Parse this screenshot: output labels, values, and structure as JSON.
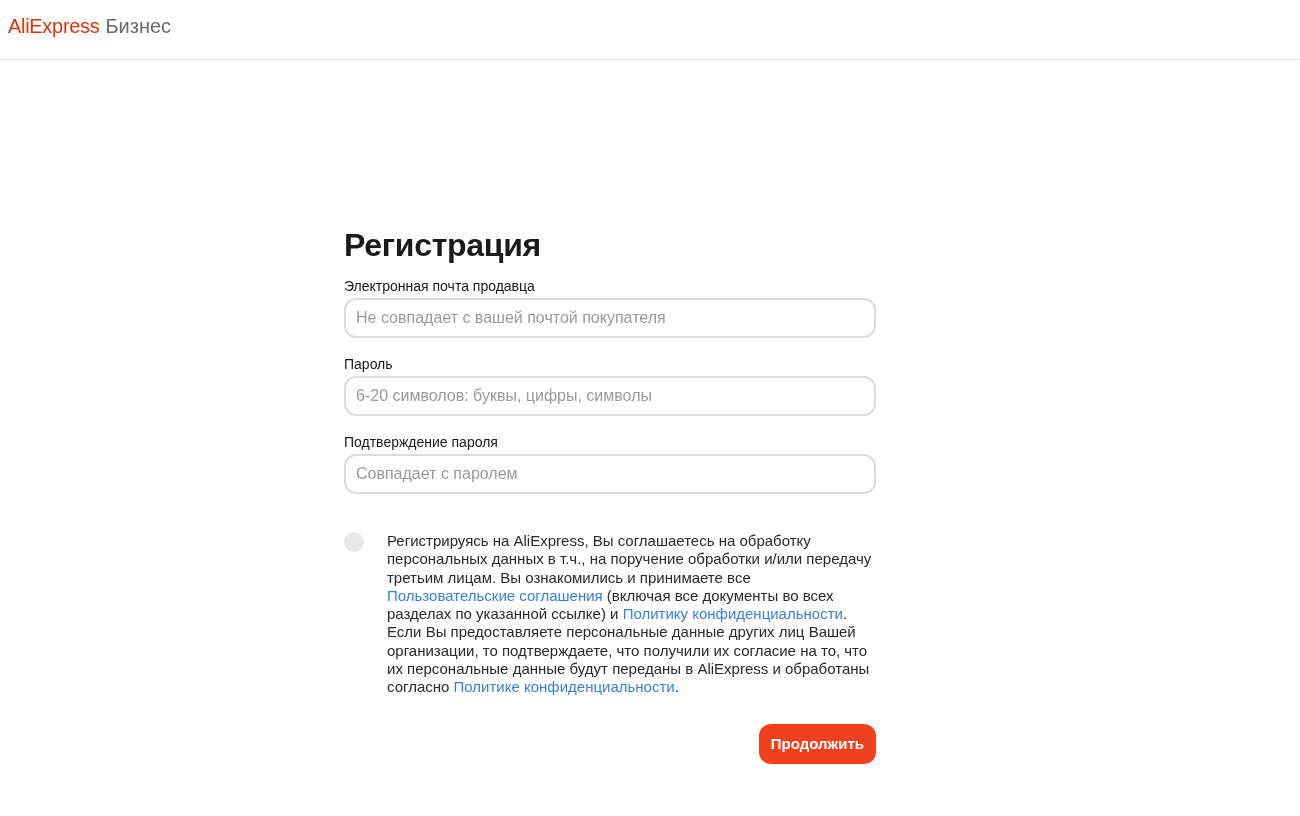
{
  "header": {
    "logo": {
      "brand": "AliExpress",
      "product": "Бизнес"
    }
  },
  "form": {
    "title": "Регистрация",
    "fields": [
      {
        "label": "Электронная почта продавца",
        "placeholder": "Не совпадает с вашей почтой покупателя"
      },
      {
        "label": "Пароль",
        "placeholder": "6-20 символов: буквы, цифры, символы"
      },
      {
        "label": "Подтверждение пароля",
        "placeholder": "Совпадает с паролем"
      }
    ],
    "consent": {
      "checked": false,
      "parts": [
        {
          "kind": "text",
          "text": "Регистрируясь на AliExpress, Вы соглашаетесь на обработку персональных данных в т.ч., на поручение обработки и/или передачу третьим лицам. Вы ознакомились и принимаете все "
        },
        {
          "kind": "link",
          "text": "Пользовательские соглашения"
        },
        {
          "kind": "text",
          "text": " (включая все документы во всех разделах по указанной ссылке) и "
        },
        {
          "kind": "link",
          "text": "Политику конфиденциальности"
        },
        {
          "kind": "text",
          "text": ". Если Вы предоставляете персональные данные других лиц Вашей организации, то подтверждаете, что получили их согласие на то, что их персональные данные будут переданы в AliExpress и обработаны согласно "
        },
        {
          "kind": "link",
          "text": "Политике конфиденциальности"
        },
        {
          "kind": "text",
          "text": "."
        }
      ]
    },
    "submit": {
      "label": "Продолжить"
    }
  }
}
